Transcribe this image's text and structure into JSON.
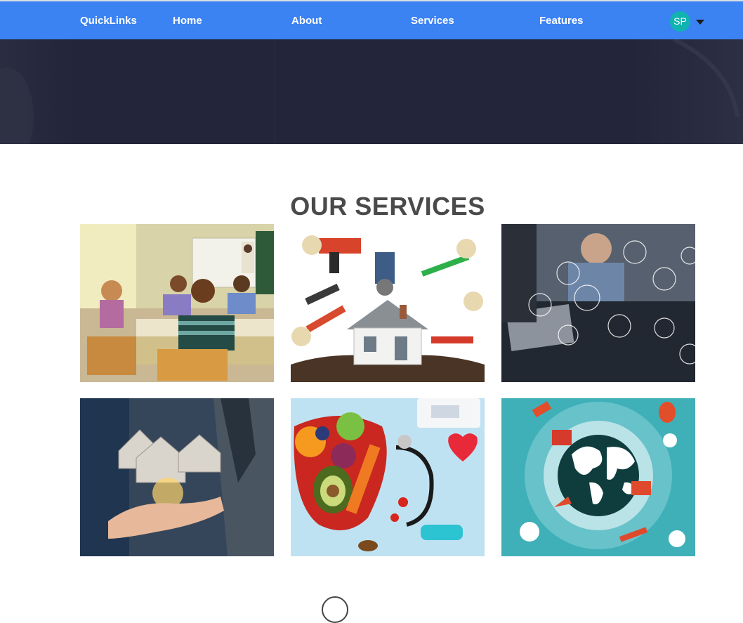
{
  "navbar": {
    "brand": "QuickLinks",
    "links": [
      "Home",
      "About",
      "Services",
      "Features"
    ],
    "user_initials": "SP",
    "colors": {
      "bar": "#3b82f3",
      "avatar": "#10b3b0"
    }
  },
  "services": {
    "title": "OUR SERVICES",
    "cards": [
      {
        "icon": "classroom-image"
      },
      {
        "icon": "home-repair-tools-image"
      },
      {
        "icon": "business-meeting-tech-image"
      },
      {
        "icon": "real-estate-hand-houses-image"
      },
      {
        "icon": "health-food-image"
      },
      {
        "icon": "travel-globe-image"
      }
    ]
  }
}
